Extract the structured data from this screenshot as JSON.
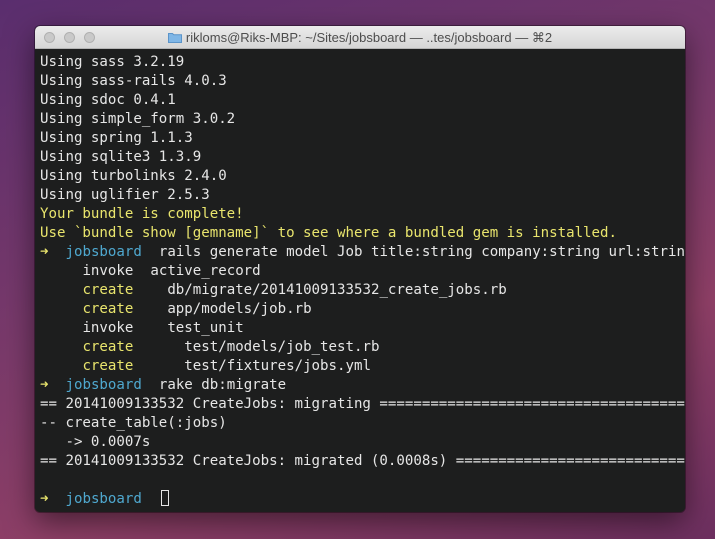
{
  "window": {
    "title": "rikloms@Riks-MBP: ~/Sites/jobsboard — ..tes/jobsboard — ⌘2"
  },
  "terminal": {
    "using": [
      "Using sass 3.2.19",
      "Using sass-rails 4.0.3",
      "Using sdoc 0.4.1",
      "Using simple_form 3.0.2",
      "Using spring 1.1.3",
      "Using sqlite3 1.3.9",
      "Using turbolinks 2.4.0",
      "Using uglifier 2.5.3"
    ],
    "complete": "Your bundle is complete!",
    "hint": "Use `bundle show [gemname]` to see where a bundled gem is installed.",
    "prompt_arrow": "➜",
    "prompt_dir": "jobsboard",
    "cmd1": "rails generate model Job title:string company:string url:string",
    "gen": [
      {
        "action": "invoke",
        "indent": "     ",
        "gap": "  ",
        "path": "active_record"
      },
      {
        "action": "create",
        "indent": "     ",
        "gap": "    ",
        "path": "db/migrate/20141009133532_create_jobs.rb"
      },
      {
        "action": "create",
        "indent": "     ",
        "gap": "    ",
        "path": "app/models/job.rb"
      },
      {
        "action": "invoke",
        "indent": "     ",
        "gap": "    ",
        "path": "test_unit"
      },
      {
        "action": "create",
        "indent": "     ",
        "gap": "      ",
        "path": "test/models/job_test.rb"
      },
      {
        "action": "create",
        "indent": "     ",
        "gap": "      ",
        "path": "test/fixtures/jobs.yml"
      }
    ],
    "cmd2": "rake db:migrate",
    "migrate": [
      "== 20141009133532 CreateJobs: migrating ======================================",
      "-- create_table(:jobs)",
      "   -> 0.0007s",
      "== 20141009133532 CreateJobs: migrated (0.0008s) ============================="
    ]
  }
}
